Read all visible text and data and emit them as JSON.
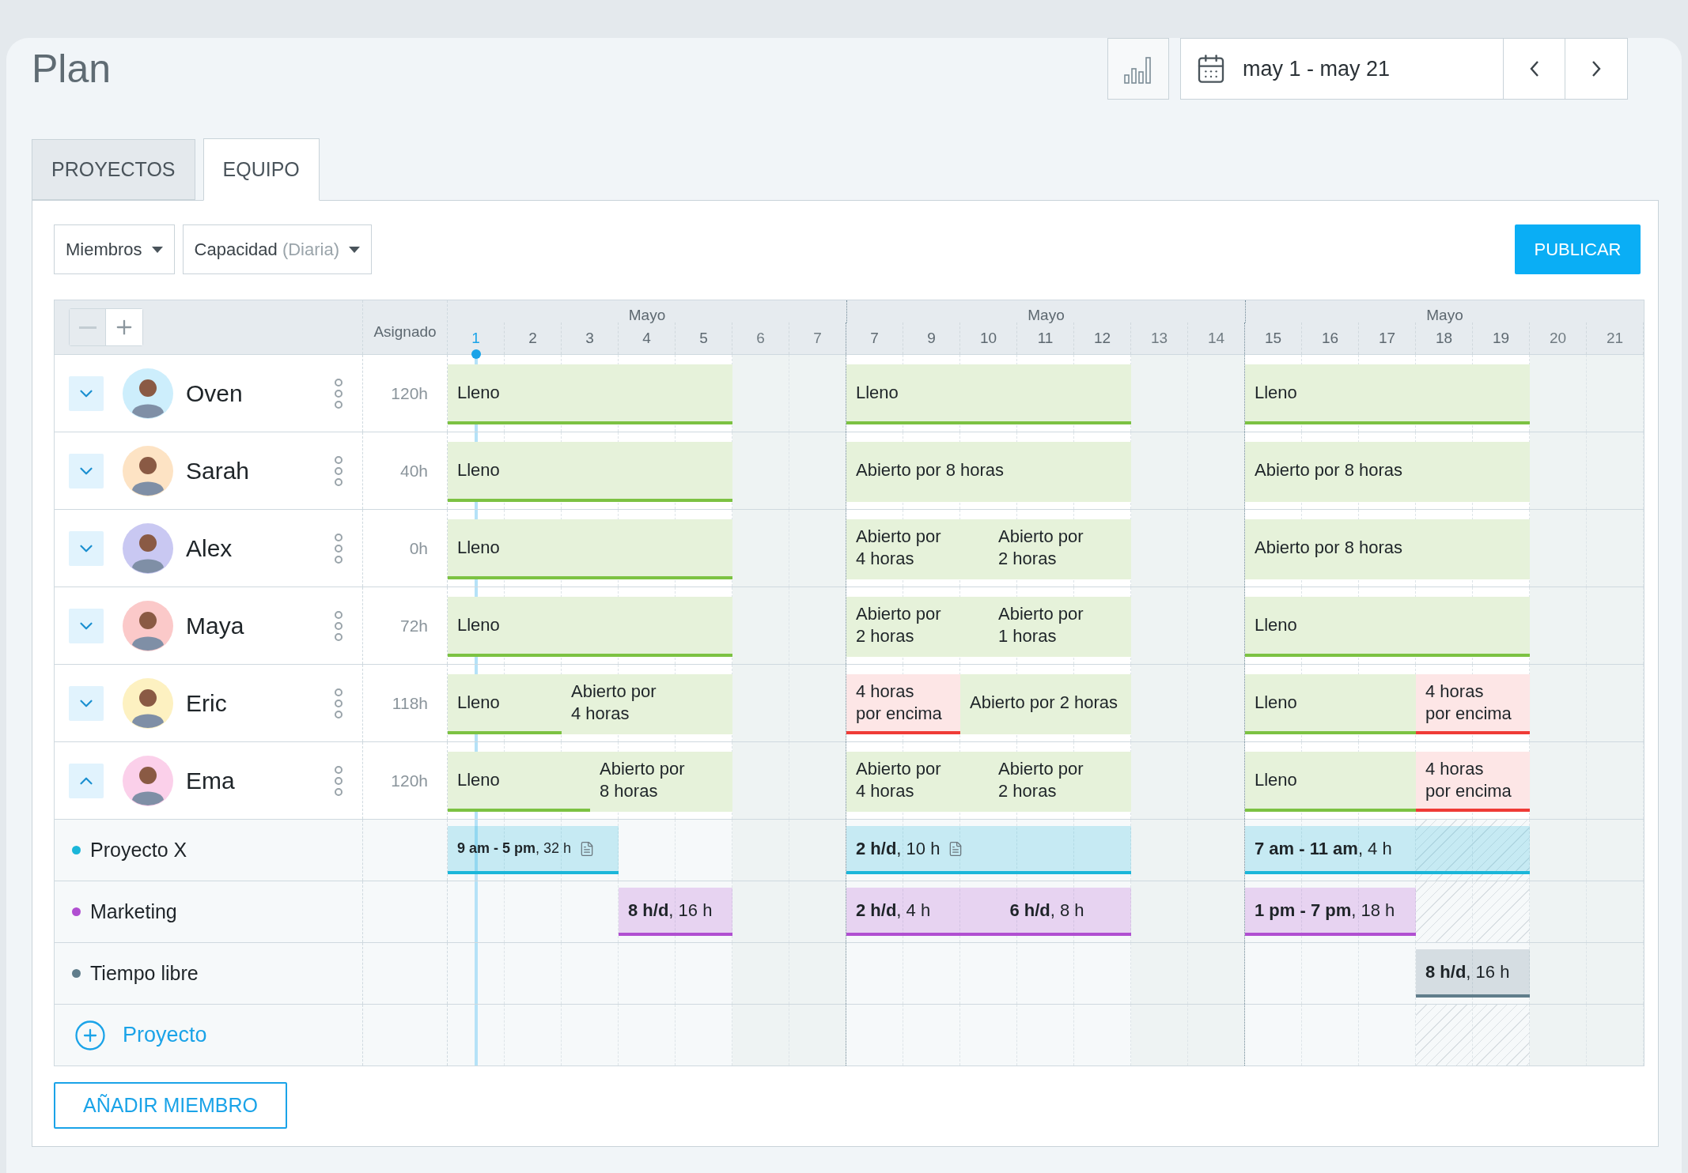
{
  "page": {
    "title": "Plan"
  },
  "toolbar": {
    "date_range": "may 1 - may 21"
  },
  "tabs": [
    {
      "label": "PROYECTOS",
      "selected": false
    },
    {
      "label": "EQUIPO",
      "selected": true
    }
  ],
  "filters": [
    {
      "label": "Miembros"
    },
    {
      "label": "Capacidad",
      "hint": "(Diaria)"
    }
  ],
  "publish_button": "PUBLICAR",
  "grid": {
    "assigned_header": "Asignado",
    "months": [
      "Mayo",
      "Mayo",
      "Mayo"
    ],
    "days": [
      {
        "label": "1",
        "today": true,
        "weekend": false
      },
      {
        "label": "2",
        "today": false,
        "weekend": false
      },
      {
        "label": "3",
        "today": false,
        "weekend": false
      },
      {
        "label": "4",
        "today": false,
        "weekend": false
      },
      {
        "label": "5",
        "today": false,
        "weekend": false
      },
      {
        "label": "6",
        "today": false,
        "weekend": true
      },
      {
        "label": "7",
        "today": false,
        "weekend": true
      },
      {
        "label": "7",
        "today": false,
        "weekend": false
      },
      {
        "label": "9",
        "today": false,
        "weekend": false
      },
      {
        "label": "10",
        "today": false,
        "weekend": false
      },
      {
        "label": "11",
        "today": false,
        "weekend": false
      },
      {
        "label": "12",
        "today": false,
        "weekend": false
      },
      {
        "label": "13",
        "today": false,
        "weekend": true
      },
      {
        "label": "14",
        "today": false,
        "weekend": true
      },
      {
        "label": "15",
        "today": false,
        "weekend": false
      },
      {
        "label": "16",
        "today": false,
        "weekend": false
      },
      {
        "label": "17",
        "today": false,
        "weekend": false
      },
      {
        "label": "18",
        "today": false,
        "weekend": false
      },
      {
        "label": "19",
        "today": false,
        "weekend": false
      },
      {
        "label": "20",
        "today": false,
        "weekend": true
      },
      {
        "label": "21",
        "today": false,
        "weekend": true
      }
    ]
  },
  "members": [
    {
      "name": "Oven",
      "color": "#cdeefc",
      "expanded": false,
      "assigned": "120h",
      "blocks": [
        {
          "text": "Lleno",
          "kind": "full"
        },
        {
          "text": "Lleno",
          "kind": "full"
        },
        {
          "text": "Lleno",
          "kind": "full"
        }
      ]
    },
    {
      "name": "Sarah",
      "color": "#fde3c4",
      "expanded": false,
      "assigned": "40h",
      "blocks": [
        {
          "text": "Lleno",
          "kind": "full"
        },
        {
          "text": "Abierto por 8 horas",
          "kind": "open"
        },
        {
          "text": "Abierto por 8 horas",
          "kind": "open"
        }
      ]
    },
    {
      "name": "Alex",
      "color": "#c9c8f2",
      "expanded": false,
      "assigned": "0h",
      "blocks": [
        {
          "text": "Lleno",
          "kind": "full"
        },
        {
          "text": "Abierto por\n4 horas",
          "kind": "open"
        },
        {
          "text": "Abierto por\n2 horas",
          "kind": "open"
        },
        {
          "text": "Abierto por 8 horas",
          "kind": "open"
        }
      ]
    },
    {
      "name": "Maya",
      "color": "#fbc9c9",
      "expanded": false,
      "assigned": "72h",
      "blocks": [
        {
          "text": "Lleno",
          "kind": "full"
        },
        {
          "text": "Abierto por\n2 horas",
          "kind": "open"
        },
        {
          "text": "Abierto por\n1 horas",
          "kind": "open"
        },
        {
          "text": "Lleno",
          "kind": "full"
        }
      ]
    },
    {
      "name": "Eric",
      "color": "#fdf1c1",
      "expanded": false,
      "assigned": "118h",
      "blocks": [
        {
          "text": "Lleno",
          "kind": "full"
        },
        {
          "text": "Abierto por\n4 horas",
          "kind": "open"
        },
        {
          "text": "4 horas\npor encima",
          "kind": "over"
        },
        {
          "text": "Abierto por 2 horas",
          "kind": "open"
        },
        {
          "text": "Lleno",
          "kind": "full"
        },
        {
          "text": "4 horas\npor encima",
          "kind": "over"
        }
      ]
    },
    {
      "name": "Ema",
      "color": "#fbd0ea",
      "expanded": true,
      "assigned": "120h",
      "blocks": [
        {
          "text": "Lleno",
          "kind": "full"
        },
        {
          "text": "Abierto por\n8 horas",
          "kind": "open"
        },
        {
          "text": "Abierto por\n4 horas",
          "kind": "open"
        },
        {
          "text": "Abierto por\n2 horas",
          "kind": "open"
        },
        {
          "text": "Lleno",
          "kind": "full"
        },
        {
          "text": "4 horas\npor encima",
          "kind": "over"
        }
      ]
    }
  ],
  "projects": [
    {
      "name": "Proyecto X",
      "color": "#1ab6d9",
      "blocks": [
        {
          "text": "**9 am - 5 pm**, 32 h",
          "note": true
        },
        {
          "text": "**2 h/d**, 10 h",
          "note": true
        },
        {
          "text": "**7 am - 11 am**, 4 h",
          "note": false
        }
      ]
    },
    {
      "name": "Marketing",
      "color": "#b04fd1",
      "blocks": [
        {
          "text": "**8 h/d**, 16 h",
          "note": false
        },
        {
          "text": "**2 h/d**, 4 h",
          "note": false
        },
        {
          "text": "**6 h/d**, 8 h",
          "note": false
        },
        {
          "text": "**1 pm - 7 pm**, 18 h",
          "note": false
        }
      ]
    },
    {
      "name": "Tiempo libre",
      "color": "#607d8b",
      "blocks": [
        {
          "text": "**8 h/d**, 16 h",
          "note": false
        }
      ]
    }
  ],
  "add_project": "Proyecto",
  "add_member_button": "AÑADIR MIEMBRO"
}
